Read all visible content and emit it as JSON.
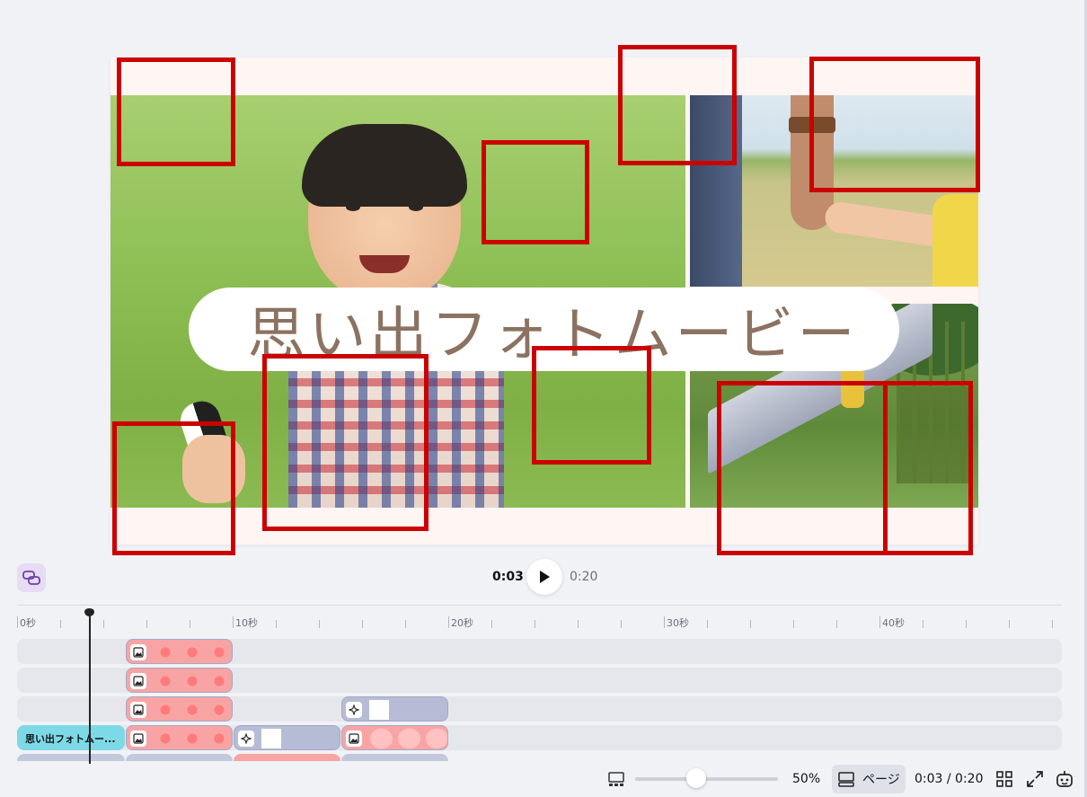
{
  "canvas": {
    "title": "思い出フォトムービー",
    "background": "#fff5f3",
    "title_color": "#8c7261"
  },
  "playback": {
    "current_time": "0:03",
    "total_time": "0:20"
  },
  "timeline": {
    "ruler_labels": [
      "0秒",
      "10秒",
      "20秒",
      "30秒",
      "40秒"
    ],
    "text_clip_label": "思い出フォトムー..."
  },
  "bottom_bar": {
    "zoom": "50%",
    "page_label": "ページ",
    "time_readout": "0:03 / 0:20"
  },
  "icons": {
    "link": "link-icon",
    "play": "play-icon",
    "image_clip": "image-icon",
    "animation_clip": "sparkle-icon",
    "layout": "layout-icon",
    "grid": "grid-icon",
    "expand": "expand-icon",
    "assistant": "assistant-icon"
  },
  "colors": {
    "annotation": "#cc0000",
    "text_clip": "#7dd9e6",
    "image_clip": "#f8a4a4",
    "animation_clip": "#b7bcd6"
  }
}
